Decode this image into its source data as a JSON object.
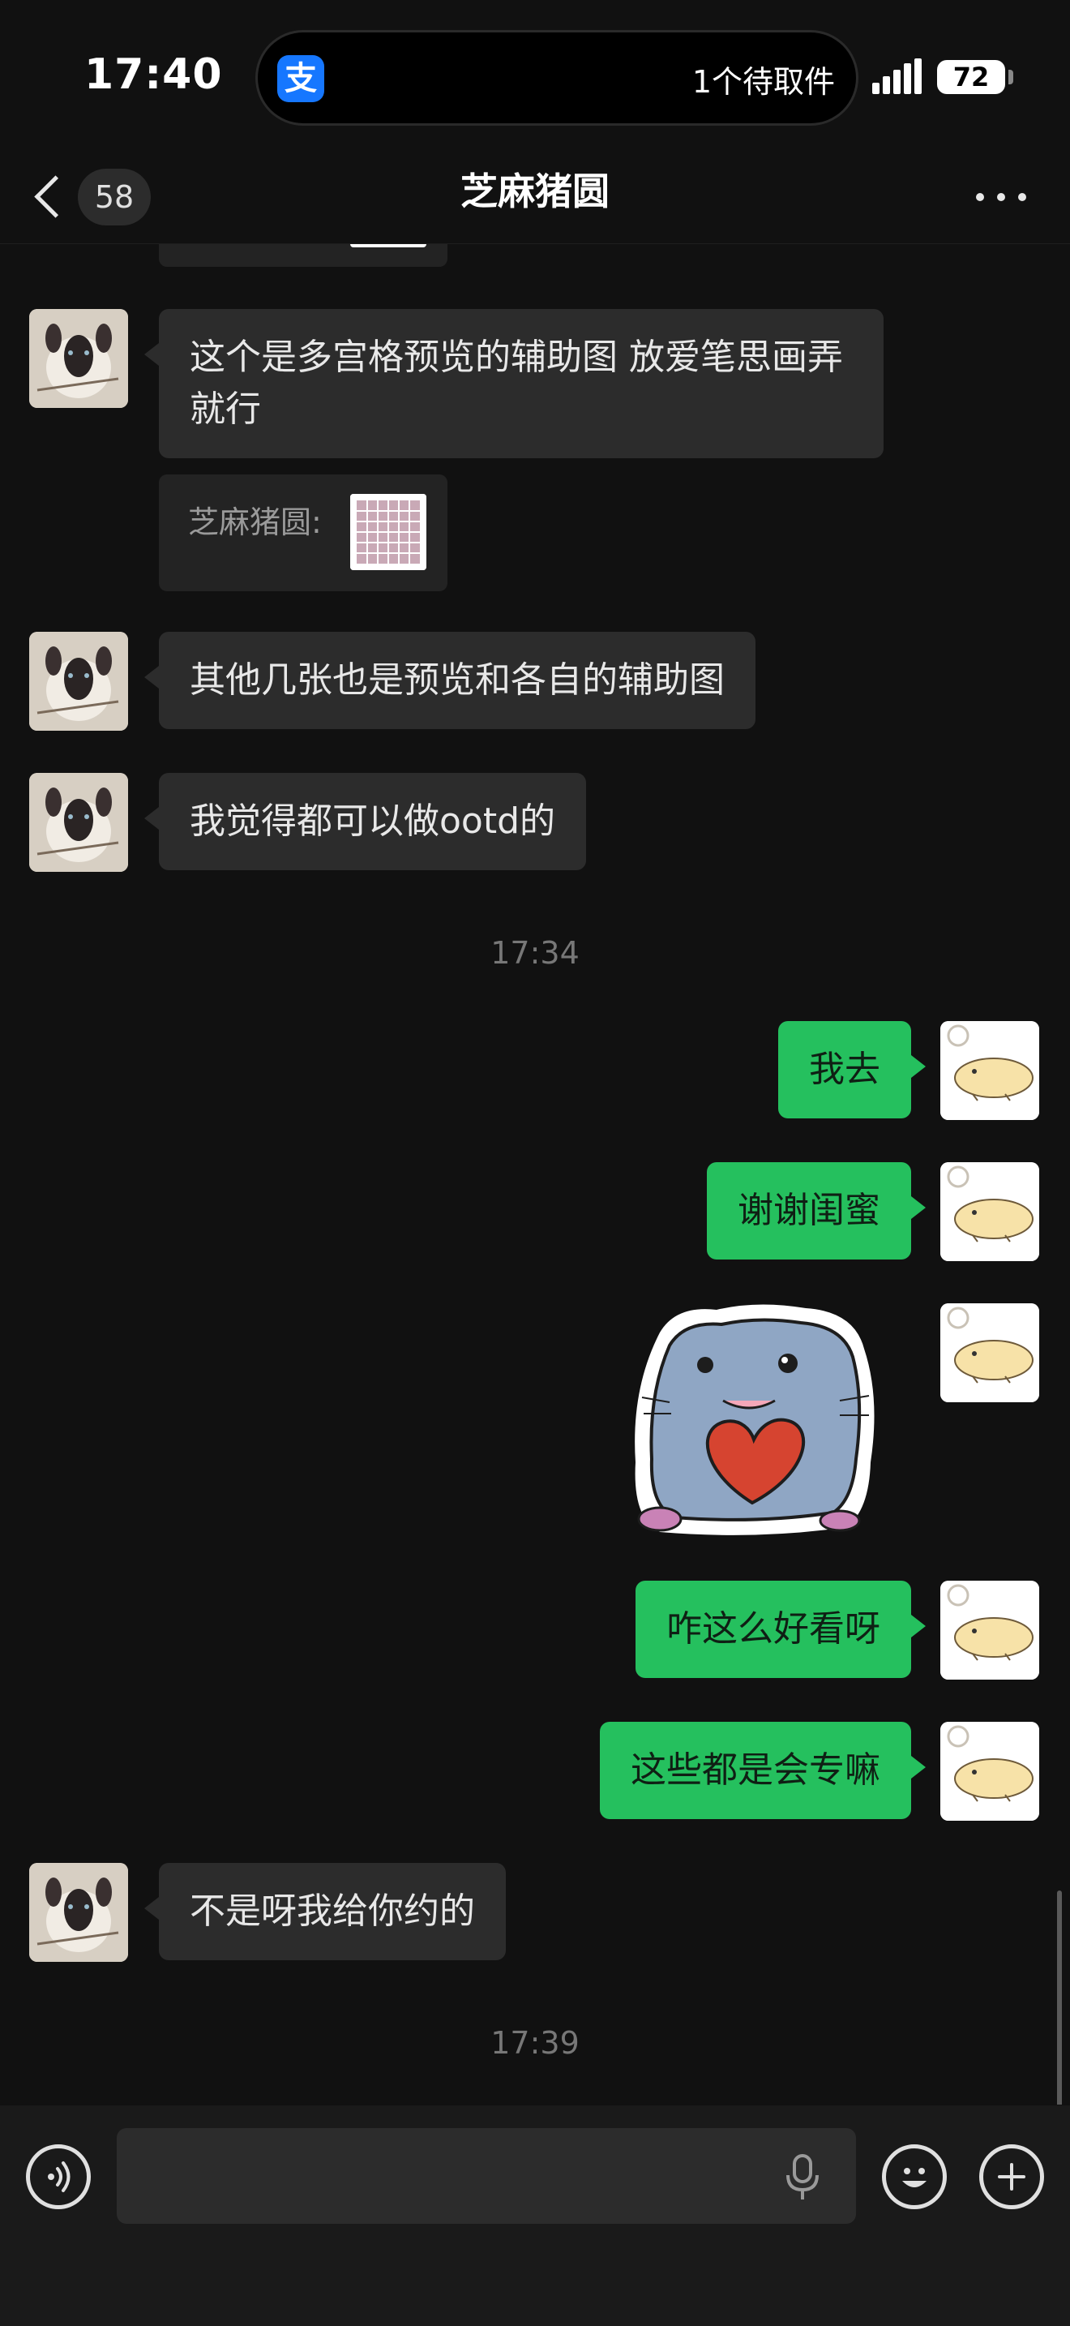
{
  "status_bar": {
    "time": "17:40",
    "alipay_glyph": "支",
    "pickup_notice": "1个待取件",
    "battery_level": "72",
    "signal_icon": "cellular-signal-icon"
  },
  "nav": {
    "title": "芝麻猪圆",
    "unread_count": "58",
    "back_icon": "chevron-left-icon",
    "more_icon": "more-dots-icon"
  },
  "messages": [
    {
      "side": "incoming",
      "type": "text",
      "text": "这个是多宫格预览的辅助图 放爱笔思画弄就行"
    },
    {
      "side": "incoming",
      "type": "quote",
      "sender": "芝麻猪圆:"
    },
    {
      "side": "incoming",
      "type": "text",
      "text": "其他几张也是预览和各自的辅助图"
    },
    {
      "side": "incoming",
      "type": "text",
      "text": "我觉得都可以做ootd的"
    },
    {
      "type": "timestamp",
      "text": "17:34"
    },
    {
      "side": "outgoing",
      "type": "text",
      "text": "我去"
    },
    {
      "side": "outgoing",
      "type": "text",
      "text": "谢谢闺蜜"
    },
    {
      "side": "outgoing",
      "type": "sticker",
      "sticker": "hamster-holding-heart-sticker"
    },
    {
      "side": "outgoing",
      "type": "text",
      "text": "咋这么好看呀"
    },
    {
      "side": "outgoing",
      "type": "text",
      "text": "这些都是会专嘛"
    },
    {
      "side": "incoming",
      "type": "text",
      "text": "不是呀我给你约的"
    },
    {
      "type": "timestamp",
      "text": "17:39"
    }
  ],
  "input_bar": {
    "placeholder": "",
    "value": "",
    "voice_icon": "voice-mode-icon",
    "mic_icon": "microphone-icon",
    "emoji_icon": "emoji-icon",
    "plus_icon": "plus-icon"
  },
  "colors": {
    "background": "#111111",
    "incoming_bubble": "#2c2c2c",
    "outgoing_bubble": "#25c05e",
    "alipay_blue": "#1677ff"
  }
}
